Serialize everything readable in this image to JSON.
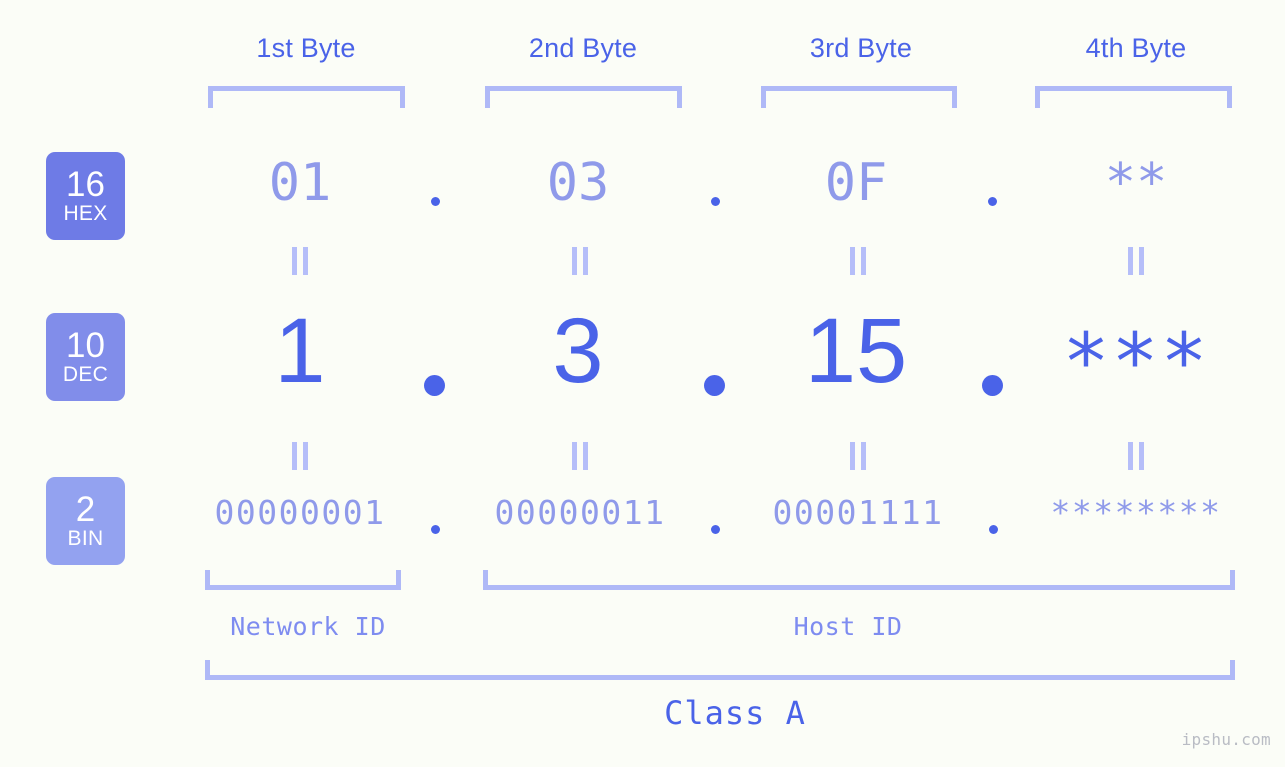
{
  "diagram": {
    "title_row": {
      "byte_labels": [
        "1st Byte",
        "2nd Byte",
        "3rd Byte",
        "4th Byte"
      ]
    },
    "rows": [
      {
        "radix": "16",
        "radix_name": "HEX",
        "badge_color": "#6e7be6",
        "values": [
          "01",
          "03",
          "0F",
          "**"
        ],
        "separator": "."
      },
      {
        "radix": "10",
        "radix_name": "DEC",
        "badge_color": "#818dea",
        "values": [
          "1",
          "3",
          "15",
          "***"
        ],
        "separator": "."
      },
      {
        "radix": "2",
        "radix_name": "BIN",
        "badge_color": "#93a2f0",
        "values": [
          "00000001",
          "00000011",
          "00001111",
          "********"
        ],
        "separator": "."
      }
    ],
    "equality_symbol": "||",
    "regions": {
      "network_id": "Network ID",
      "host_id": "Host ID"
    },
    "class_label": "Class A",
    "watermark": "ipshu.com",
    "colors": {
      "background": "#fbfdf7",
      "accent_strong": "#4a63e8",
      "accent_light": "#8f9aea",
      "bracket": "#afb9f7"
    }
  }
}
